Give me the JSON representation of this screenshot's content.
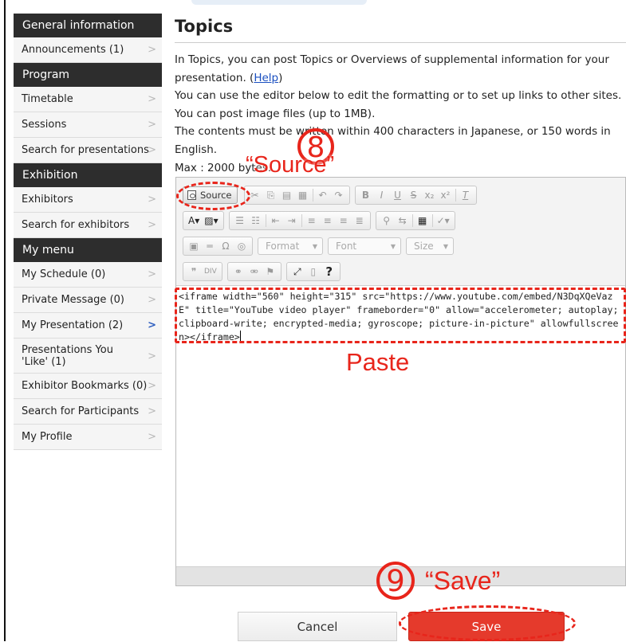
{
  "sidebar": {
    "sections": [
      {
        "heading": "General information",
        "items": [
          {
            "label": "Announcements (1)"
          }
        ]
      },
      {
        "heading": "Program",
        "items": [
          {
            "label": "Timetable"
          },
          {
            "label": "Sessions"
          },
          {
            "label": "Search for presentations"
          }
        ]
      },
      {
        "heading": "Exhibition",
        "items": [
          {
            "label": "Exhibitors"
          },
          {
            "label": "Search for exhibitors"
          }
        ]
      },
      {
        "heading": "My menu",
        "items": [
          {
            "label": "My Schedule (0)"
          },
          {
            "label": "Private Message (0)"
          },
          {
            "label": "My Presentation (2)"
          },
          {
            "label": "Presentations You 'Like' (1)"
          },
          {
            "label": "Exhibitor Bookmarks (0)"
          },
          {
            "label": "Search for Participants"
          },
          {
            "label": "My Profile"
          }
        ]
      }
    ]
  },
  "main": {
    "title": "Topics",
    "desc_line1": "In Topics, you can post Topics or Overviews of supplemental information for your presentation. (",
    "help_link": "Help",
    "desc_line1_end": ")",
    "desc_line2": "You can use the editor below to edit the formatting or to set up links to other sites.",
    "desc_line3": "You can post image files (up to 1MB).",
    "desc_line4": "The contents must be written within 400 characters in Japanese, or 150 words in English.",
    "max_label": "Max : 2000 bytes."
  },
  "editor": {
    "source_label": "Source",
    "format_label": "Format",
    "font_label": "Font",
    "size_label": "Size",
    "content": "<iframe width=\"560\" height=\"315\" src=\"https://www.youtube.com/embed/N3DqXQeVazE\" title=\"YouTube video player\" frameborder=\"0\" allow=\"accelerometer; autoplay; clipboard-write; encrypted-media; gyroscope; picture-in-picture\" allowfullscreen></iframe>"
  },
  "buttons": {
    "cancel": "Cancel",
    "save": "Save"
  },
  "annotations": {
    "step8_number": "8",
    "step8_label": "“Source”",
    "paste_label": "Paste",
    "step9_number": "9",
    "step9_label": "“Save”"
  },
  "colors": {
    "sidebar_heading": "#2d2d2d",
    "save_button": "#e53a2c",
    "annotation_red": "#e8251b",
    "link": "#1a4fc0"
  },
  "icons": [
    "chevron-right-icon",
    "source-icon",
    "cut-icon",
    "copy-icon",
    "paste-icon",
    "paste-text-icon",
    "undo-icon",
    "redo-icon",
    "bold-icon",
    "italic-icon",
    "underline-icon",
    "strike-icon",
    "subscript-icon",
    "superscript-icon",
    "remove-format-icon",
    "text-color-icon",
    "bg-color-icon",
    "numbered-list-icon",
    "bulleted-list-icon",
    "outdent-icon",
    "indent-icon",
    "align-left-icon",
    "align-center-icon",
    "align-right-icon",
    "justify-icon",
    "find-icon",
    "replace-icon",
    "select-all-icon",
    "spellcheck-icon",
    "image-icon",
    "horizontal-rule-icon",
    "omega-icon",
    "iframe-icon",
    "blockquote-icon",
    "div-icon",
    "link-icon",
    "unlink-icon",
    "anchor-icon",
    "maximize-icon",
    "show-blocks-icon",
    "help-icon"
  ]
}
